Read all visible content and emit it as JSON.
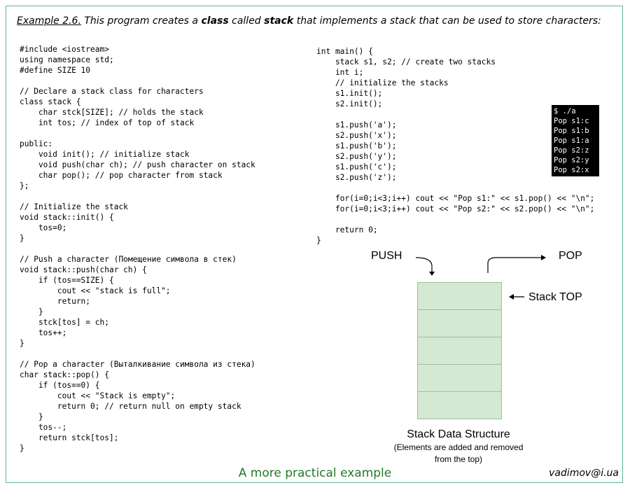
{
  "header": {
    "example_label": "Example 2.6.",
    "part1": " This program creates a ",
    "bold1": "class",
    "part2": " called ",
    "bold2": "stack",
    "part3": " that implements a stack that can be used to store characters:"
  },
  "code_left": [
    "#include <iostream>",
    "using namespace std;",
    "#define SIZE 10",
    "",
    "// Declare a stack class for characters",
    "class stack {",
    "    char stck[SIZE]; // holds the stack",
    "    int tos; // index of top of stack",
    "",
    "public:",
    "    void init(); // initialize stack",
    "    void push(char ch); // push character on stack",
    "    char pop(); // pop character from stack",
    "};",
    "",
    "// Initialize the stack",
    "void stack::init() {",
    "    tos=0;",
    "}",
    "",
    "// Push a character (Помещение символа в стек)",
    "void stack::push(char ch) {",
    "    if (tos==SIZE) {",
    "        cout << \"stack is full\";",
    "        return;",
    "    }",
    "    stck[tos] = ch;",
    "    tos++;",
    "}",
    "",
    "// Pop a character (Выталкивание символа из стека)",
    "char stack::pop() {",
    "    if (tos==0) {",
    "        cout << \"Stack is empty\";",
    "        return 0; // return null on empty stack",
    "    }",
    "    tos--;",
    "    return stck[tos];",
    "}"
  ],
  "code_right": [
    "int main() {",
    "    stack s1, s2; // create two stacks",
    "    int i;",
    "    // initialize the stacks",
    "    s1.init();",
    "    s2.init();",
    "",
    "    s1.push('a');",
    "    s2.push('x');",
    "    s1.push('b');",
    "    s2.push('y');",
    "    s1.push('c');",
    "    s2.push('z');",
    "",
    "    for(i=0;i<3;i++) cout << \"Pop s1:\" << s1.pop() << \"\\n\";",
    "    for(i=0;i<3;i++) cout << \"Pop s2:\" << s2.pop() << \"\\n\";",
    "",
    "    return 0;",
    "}"
  ],
  "terminal": [
    "$ ./a",
    "Pop s1:c",
    "Pop s1:b",
    "Pop s1:a",
    "Pop s2:z",
    "Pop s2:y",
    "Pop s2:x"
  ],
  "diagram": {
    "push_label": "PUSH",
    "pop_label": "POP",
    "top_label": "Stack TOP",
    "title": "Stack Data Structure",
    "subtitle_line1": "(Elements are added and removed",
    "subtitle_line2": "from the top)",
    "cell_color": "#d5e8d4"
  },
  "footer": {
    "title": "A more practical example",
    "email": "vadimov@i.ua",
    "title_color": "#1f7a2a"
  }
}
